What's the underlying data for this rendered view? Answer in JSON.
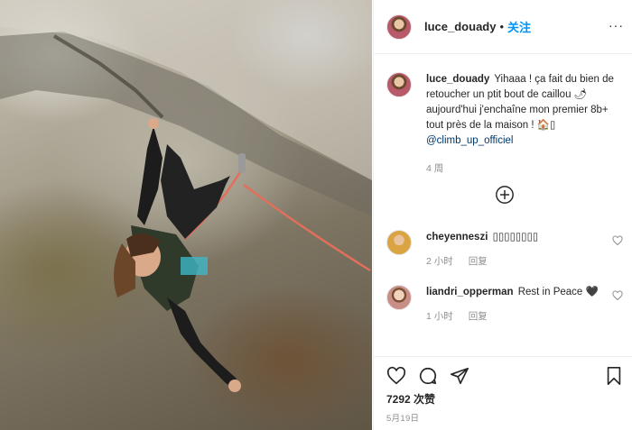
{
  "photo": {
    "alt_icon": "climber-photo"
  },
  "header": {
    "username": "luce_douady",
    "separator": "•",
    "follow_label": "关注",
    "more_label": "···"
  },
  "caption": {
    "username": "luce_douady",
    "text_1": "Yihaaa ! ça fait du bien de retoucher un ptit bout de caillou 🌶 aujourd'hui j'enchaîne mon premier 8b+ tout près de la maison ! 🏠▯",
    "mention": "@climb_up_officiel",
    "time": "4 周"
  },
  "comments": [
    {
      "username": "cheyenneszi",
      "text": "▯▯▯▯▯▯▯▯",
      "time": "2 小时",
      "reply_label": "回复",
      "avatar_color": "#d9a441"
    },
    {
      "username": "liandri_opperman",
      "text": "Rest in Peace 🖤",
      "time": "1 小时",
      "reply_label": "回复",
      "avatar_color": "#c98f86"
    }
  ],
  "actions": {
    "likes": "7292 次赞",
    "date": "5月19日"
  },
  "colors": {
    "link": "#0095f6",
    "mention": "#00376b",
    "muted": "#8e8e8e",
    "text": "#262626"
  }
}
